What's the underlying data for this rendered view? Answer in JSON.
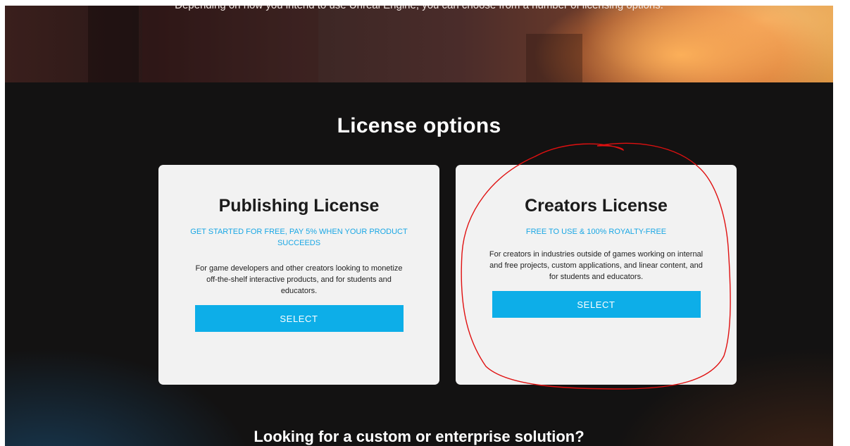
{
  "hero": {
    "subtitle": "Depending on how you intend to use Unreal Engine, you can choose from a number of licensing options."
  },
  "section": {
    "title": "License options"
  },
  "cards": [
    {
      "title": "Publishing License",
      "tagline": "GET STARTED FOR FREE, PAY 5% WHEN YOUR PRODUCT SUCCEEDS",
      "description": "For game developers and other creators looking to monetize off-the-shelf interactive products, and for students and educators.",
      "button": "SELECT"
    },
    {
      "title": "Creators License",
      "tagline": "FREE TO USE & 100% ROYALTY-FREE",
      "description": "For creators in industries outside of games working on internal and free projects, custom applications, and linear content, and for students and educators.",
      "button": "SELECT"
    }
  ],
  "bottom": {
    "title": "Looking for a custom or enterprise solution?"
  },
  "colors": {
    "accent": "#0daee8",
    "tagline": "#1aa7e4",
    "annotation": "#e01010"
  }
}
